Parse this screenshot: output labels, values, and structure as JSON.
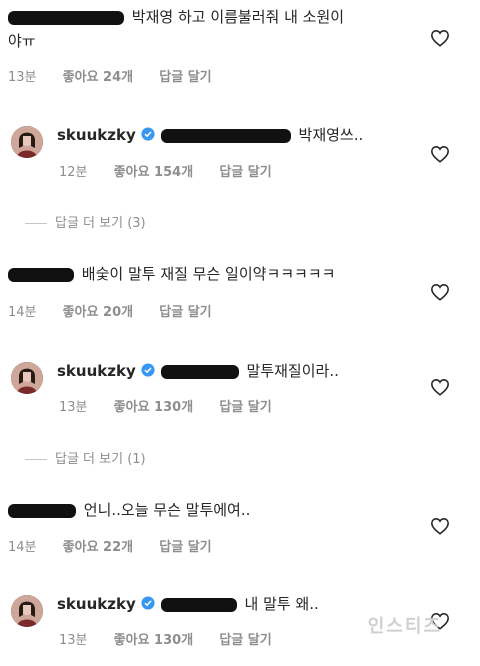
{
  "comments": [
    {
      "text": "박재영 하고 이름불러줘 내 소원이",
      "text_wrap": "야ㅠ",
      "time": "13분",
      "likes": "좋아요 24개",
      "reply": "답글 달기"
    },
    {
      "user": "skuukzky",
      "text": "박재영쓰..",
      "time": "12분",
      "likes": "좋아요 154개",
      "reply": "답글 달기"
    },
    {
      "text": "배숯이 말투 재질 무슨 일이약ㅋㅋㅋㅋㅋ",
      "time": "14분",
      "likes": "좋아요 20개",
      "reply": "답글 달기"
    },
    {
      "user": "skuukzky",
      "text": "말투재질이라..",
      "time": "13분",
      "likes": "좋아요 130개",
      "reply": "답글 달기"
    },
    {
      "text": "언니..오늘 무슨 말투에여..",
      "time": "14분",
      "likes": "좋아요 22개",
      "reply": "답글 달기"
    },
    {
      "user": "skuukzky",
      "text": "내 말투 왜..",
      "time": "13분",
      "likes": "좋아요 130개",
      "reply": "답글 달기"
    }
  ],
  "view_more": [
    "답글 더 보기 (3)",
    "답글 더 보기 (1)"
  ],
  "watermark": "인스티즈",
  "colors": {
    "meta": "#8e8e8e",
    "verified": "#3897f0",
    "text": "#262626"
  },
  "icons": {
    "like": "heart-outline-icon",
    "verified": "verified-badge-icon"
  }
}
